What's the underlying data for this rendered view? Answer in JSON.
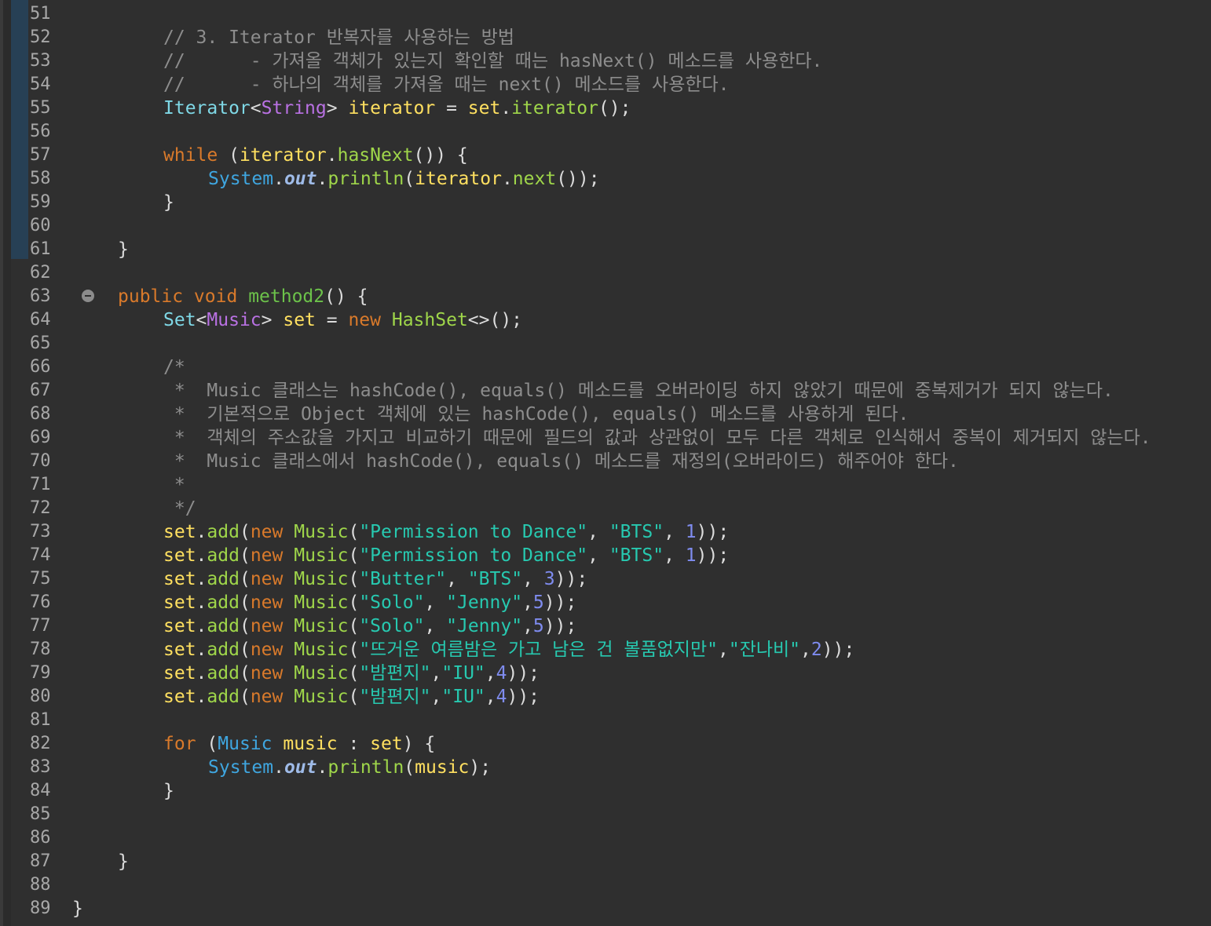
{
  "editor": {
    "line_numbers": [
      "51",
      "52",
      "53",
      "54",
      "55",
      "56",
      "57",
      "58",
      "59",
      "60",
      "61",
      "62",
      "63",
      "64",
      "65",
      "66",
      "67",
      "68",
      "69",
      "70",
      "71",
      "72",
      "73",
      "74",
      "75",
      "76",
      "77",
      "78",
      "79",
      "80",
      "81",
      "82",
      "83",
      "84",
      "85",
      "86",
      "87",
      "88",
      "89"
    ],
    "comments": {
      "c52": "// 3. Iterator 반복자를 사용하는 방법",
      "c53": "//      - 가져올 객체가 있는지 확인할 때는 hasNext() 메소드를 사용한다.",
      "c54": "//      - 하나의 객체를 가져올 때는 next() 메소드를 사용한다.",
      "c66": "/*",
      "c67": " *  Music 클래스는 hashCode(), equals() 메소드를 오버라이딩 하지 않았기 때문에 중복제거가 되지 않는다.",
      "c68": " *  기본적으로 Object 객체에 있는 hashCode(), equals() 메소드를 사용하게 된다.",
      "c69": " *  객체의 주소값을 가지고 비교하기 때문에 필드의 값과 상관없이 모두 다른 객체로 인식해서 중복이 제거되지 않는다.",
      "c70": " *  Music 클래스에서 hashCode(), equals() 메소드를 재정의(오버라이드) 해주어야 한다.",
      "c71": " *",
      "c72": " */"
    },
    "strings": {
      "s73a": "\"Permission to Dance\"",
      "s73b": "\"BTS\"",
      "s74a": "\"Permission to Dance\"",
      "s74b": "\"BTS\"",
      "s75a": "\"Butter\"",
      "s75b": "\"BTS\"",
      "s76a": "\"Solo\"",
      "s76b": "\"Jenny\"",
      "s77a": "\"Solo\"",
      "s77b": "\"Jenny\"",
      "s78a": "\"뜨거운 여름밤은 가고 남은 건 볼품없지만\"",
      "s78b": "\"잔나비\"",
      "s79a": "\"밤편지\"",
      "s79b": "\"IU\"",
      "s80a": "\"밤편지\"",
      "s80b": "\"IU\""
    },
    "numbers": {
      "n73": "1",
      "n74": "1",
      "n75": "3",
      "n76": "5",
      "n77": "5",
      "n78": "2",
      "n79": "4",
      "n80": "4"
    }
  }
}
